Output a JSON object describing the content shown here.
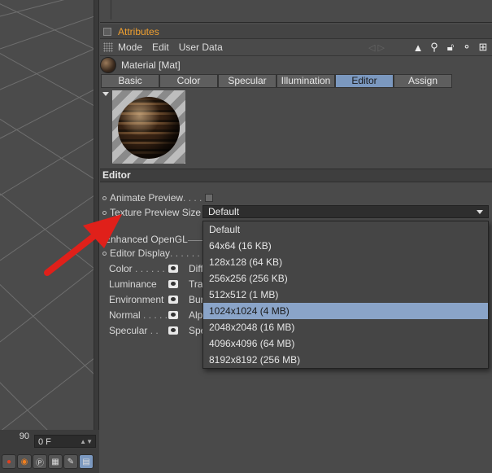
{
  "timeline": {
    "ruler_value": "90",
    "frame_value": "0 F"
  },
  "attributes": {
    "title": "Attributes",
    "menu": [
      "Mode",
      "Edit",
      "User Data"
    ],
    "material_name": "Material [Mat]",
    "tabs": [
      {
        "label": "Basic",
        "active": false
      },
      {
        "label": "Color",
        "active": false
      },
      {
        "label": "Specular",
        "active": false
      },
      {
        "label": "Illumination",
        "active": false
      },
      {
        "label": "Editor",
        "active": true
      },
      {
        "label": "Assign",
        "active": false
      }
    ],
    "section": "Editor",
    "animate_preview_label": "Animate Preview",
    "animate_preview_dots": " . . . .",
    "texture_preview_label": "Texture Preview Size",
    "texture_preview_value": "Default",
    "enhanced_opengl_label": "Enhanced OpenGL",
    "editor_display_label": "Editor Display",
    "editor_display_dots": " . . . . . .",
    "channels_left": [
      {
        "label": "Color",
        "dots": " . . . . . . ."
      },
      {
        "label": "Luminance",
        "dots": ""
      },
      {
        "label": "Environment",
        "dots": ""
      },
      {
        "label": "Normal",
        "dots": " . . . . ."
      },
      {
        "label": "Specular",
        "dots": " . ."
      }
    ],
    "channels_right": [
      "Diff",
      "Tra",
      "Bur",
      "Alp",
      "Spe"
    ]
  },
  "dropdown": {
    "options": [
      {
        "label": "Default",
        "highlighted": false
      },
      {
        "label": "64x64 (16 KB)",
        "highlighted": false
      },
      {
        "label": "128x128 (64 KB)",
        "highlighted": false
      },
      {
        "label": "256x256 (256 KB)",
        "highlighted": false
      },
      {
        "label": "512x512 (1 MB)",
        "highlighted": false
      },
      {
        "label": "1024x1024 (4 MB)",
        "highlighted": true
      },
      {
        "label": "2048x2048 (16 MB)",
        "highlighted": false
      },
      {
        "label": "4096x4096 (64 MB)",
        "highlighted": false
      },
      {
        "label": "8192x8192 (256 MB)",
        "highlighted": false
      }
    ]
  },
  "colors": {
    "accent_title": "#f0a030",
    "tab_active": "#7b98bf",
    "option_highlight": "#8aa4c8",
    "annotation_arrow": "#e0201a"
  },
  "icons": {
    "toolbar": [
      "arrow-up-icon",
      "search-icon",
      "lock-icon",
      "hierarchy-icon",
      "new-panel-icon"
    ],
    "timeline": [
      "record-icon",
      "keyframe-icon",
      "p-icon",
      "grid-icon",
      "key-icon",
      "page-icon"
    ]
  }
}
